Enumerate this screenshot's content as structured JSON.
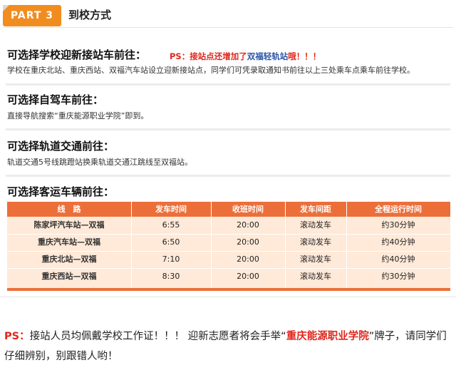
{
  "header": {
    "badge": "PART 3",
    "title": "到校方式"
  },
  "sections": {
    "pickup": {
      "title": "可选择学校迎新接站车前往：",
      "ps_prefix": "PS：接站点还增加了",
      "ps_highlight": "双福轻轨站",
      "ps_suffix": "哦！！！",
      "body": "学校在重庆北站、重庆西站、双福汽车站设立迎新接站点，同学们可凭录取通知书前往以上三处乘车点乘车前往学校。"
    },
    "drive": {
      "title": "可选择自驾车前往：",
      "body": "直接导航搜索“重庆能源职业学院”即到。"
    },
    "rail": {
      "title": "可选择轨道交通前往：",
      "body": "轨道交通5号线跳蹬站换乘轨道交通江跳线至双福站。"
    },
    "bus": {
      "title": "可选择客运车辆前往："
    }
  },
  "table": {
    "headers": [
      "线　路",
      "发车时间",
      "收班时间",
      "发车间距",
      "全程运行时间"
    ],
    "rows": [
      [
        "陈家坪汽车站—双福",
        "6:55",
        "20:00",
        "滚动发车",
        "约30分钟"
      ],
      [
        "重庆汽车站—双福",
        "6:50",
        "20:00",
        "滚动发车",
        "约40分钟"
      ],
      [
        "重庆北站—双福",
        "7:10",
        "20:00",
        "滚动发车",
        "约40分钟"
      ],
      [
        "重庆西站—双福",
        "8:30",
        "20:00",
        "滚动发车",
        "约30分钟"
      ]
    ]
  },
  "footer": {
    "ps": "PS：",
    "text1": "接站人员均佩戴学校工作证！！！ 迎新志愿者将会手举“",
    "school": "重庆能源职业学院",
    "text2": "”牌子，请同学们仔细辨别，别跟错人哟！"
  },
  "colors": {
    "orange": "#f18c1e",
    "table_header": "#ec6f3a",
    "table_bg": "#ffe9d8",
    "red": "#e0271c",
    "blue": "#2a55a8"
  }
}
